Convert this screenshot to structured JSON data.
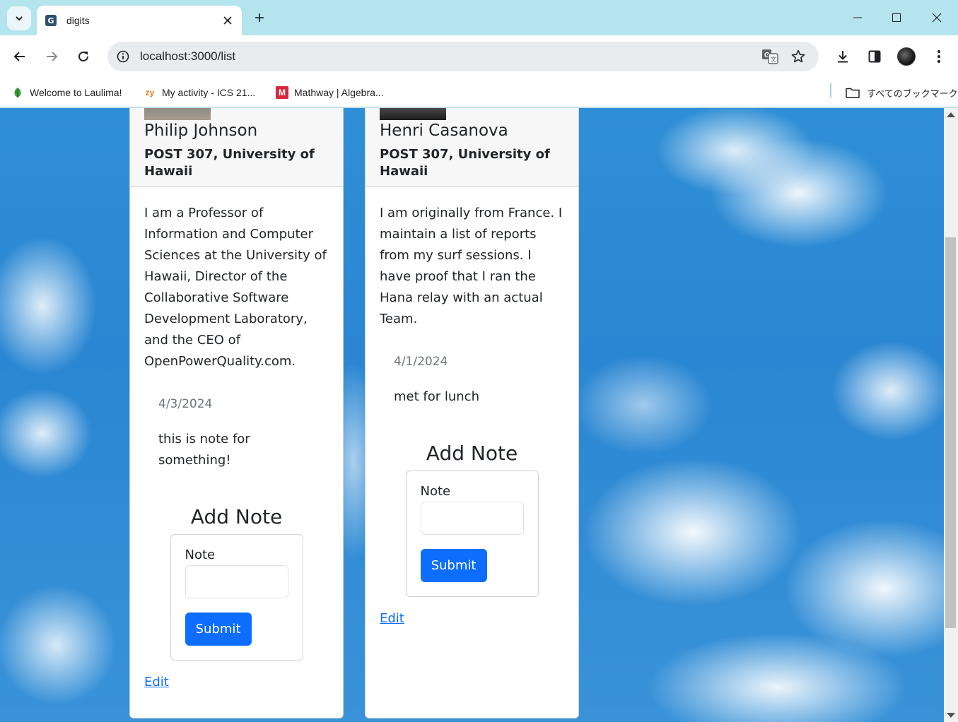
{
  "browser": {
    "tab_title": "digits",
    "url": "localhost:3000/list",
    "new_tab_label": "+",
    "bookmarks": [
      {
        "label": "Welcome to Laulima!",
        "icon": "laulima-leaf-icon"
      },
      {
        "label": "My activity - ICS 21...",
        "icon": "zybooks-icon"
      },
      {
        "label": "Mathway | Algebra...",
        "icon": "mathway-icon"
      }
    ],
    "all_bookmarks_label": "すべてのブックマーク",
    "colors": {
      "tabstrip": "#b4e4ee",
      "omnibox": "#e9ecef"
    }
  },
  "page": {
    "contacts": [
      {
        "name": "Philip Johnson",
        "address": "POST 307, University of Hawaii",
        "description": "I am a Professor of Information and Computer Sciences at the University of Hawaii, Director of the Collaborative Software Development Laboratory, and the CEO of OpenPowerQuality.com.",
        "note_date": "4/3/2024",
        "note_text": "this is note for something!",
        "add_note_title": "Add Note",
        "note_label": "Note",
        "submit_label": "Submit",
        "edit_label": "Edit"
      },
      {
        "name": "Henri Casanova",
        "address": "POST 307, University of Hawaii",
        "description": "I am originally from France. I maintain a list of reports from my surf sessions. I have proof that I ran the Hana relay with an actual Team.",
        "note_date": "4/1/2024",
        "note_text": "met for lunch",
        "add_note_title": "Add Note",
        "note_label": "Note",
        "submit_label": "Submit",
        "edit_label": "Edit"
      }
    ],
    "colors": {
      "primary": "#0d6efd",
      "card_header": "#f7f7f7",
      "text": "#212529",
      "muted": "#6c757d"
    }
  }
}
